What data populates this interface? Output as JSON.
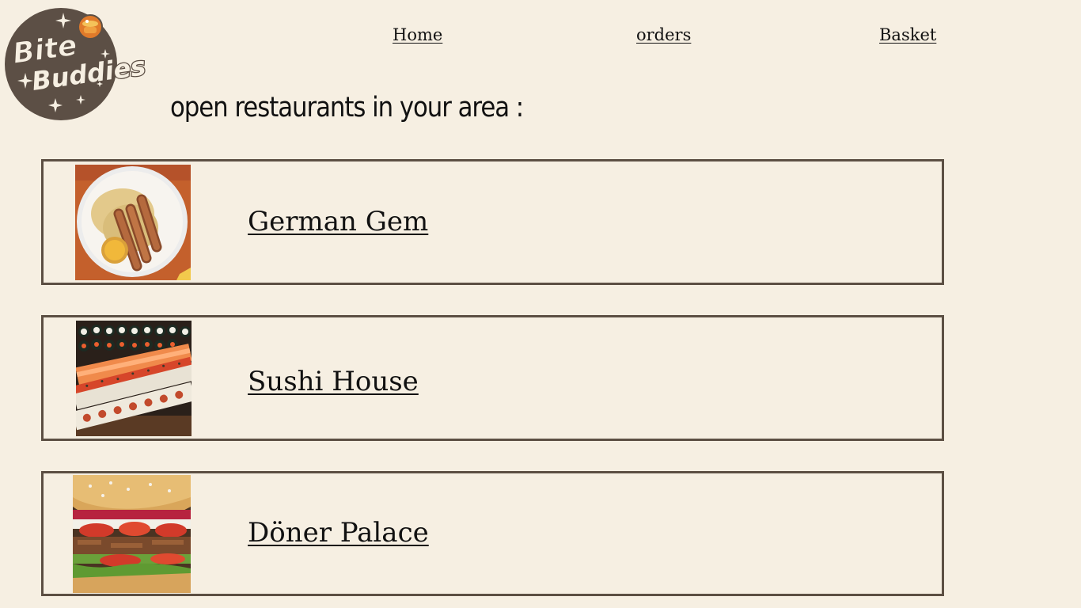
{
  "logo": {
    "line1": "Bite",
    "line2": "Buddies",
    "icon": "cooking-pot-icon",
    "badge_color": "#5c4f45"
  },
  "nav": {
    "home": "Home",
    "orders": "orders",
    "basket": "Basket"
  },
  "heading": "open restaurants in your area :",
  "restaurants": [
    {
      "name": "German Gem",
      "image": "sausages-plate-photo"
    },
    {
      "name": "Sushi House",
      "image": "sushi-rolls-photo"
    },
    {
      "name": "Döner Palace",
      "image": "doner-kebab-photo"
    }
  ],
  "colors": {
    "background": "#f6efe2",
    "card_border": "#5c4f43",
    "text": "#111111"
  }
}
